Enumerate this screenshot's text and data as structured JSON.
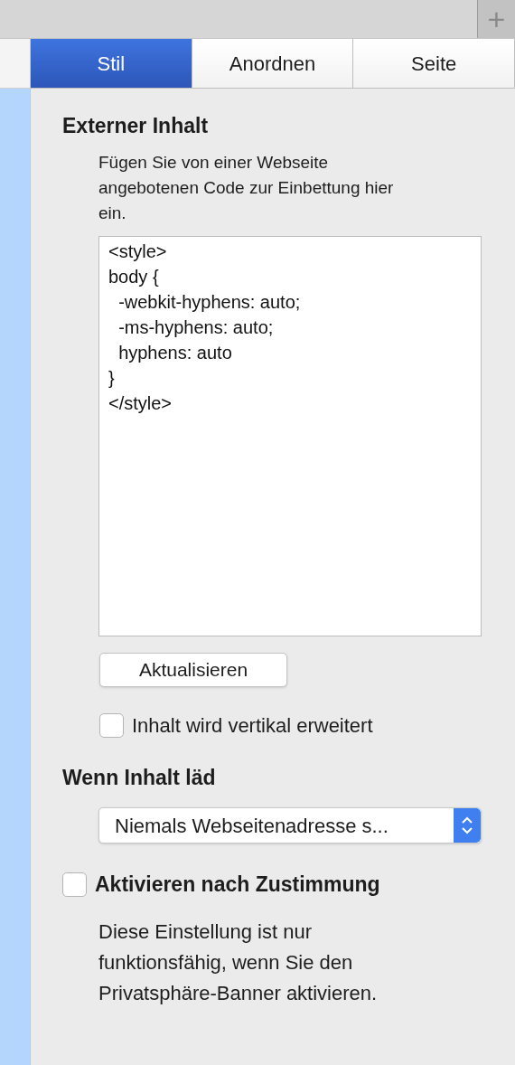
{
  "toolbar": {
    "add_button": "+"
  },
  "tabs": [
    {
      "label": "Stil",
      "selected": true
    },
    {
      "label": "Anordnen",
      "selected": false
    },
    {
      "label": "Seite",
      "selected": false
    }
  ],
  "external_content": {
    "heading": "Externer Inhalt",
    "description": "Fügen Sie von einer Webseite angebotenen Code zur Einbettung hier ein.",
    "code": "<style>\nbody {\n  -webkit-hyphens: auto;\n  -ms-hyphens: auto;\n  hyphens: auto\n}\n</style>",
    "update_button": "Aktualisieren",
    "expand_checkbox": {
      "label": "Inhalt wird vertikal erweitert",
      "checked": false
    }
  },
  "on_load": {
    "heading": "Wenn Inhalt läd",
    "select_value": "Niemals Webseitenadresse s..."
  },
  "consent": {
    "label": "Aktivieren nach Zustimmung",
    "checked": false,
    "note": "Diese Einstellung ist nur funktionsfähig, wenn Sie den Privatsphäre-Banner aktivieren."
  }
}
